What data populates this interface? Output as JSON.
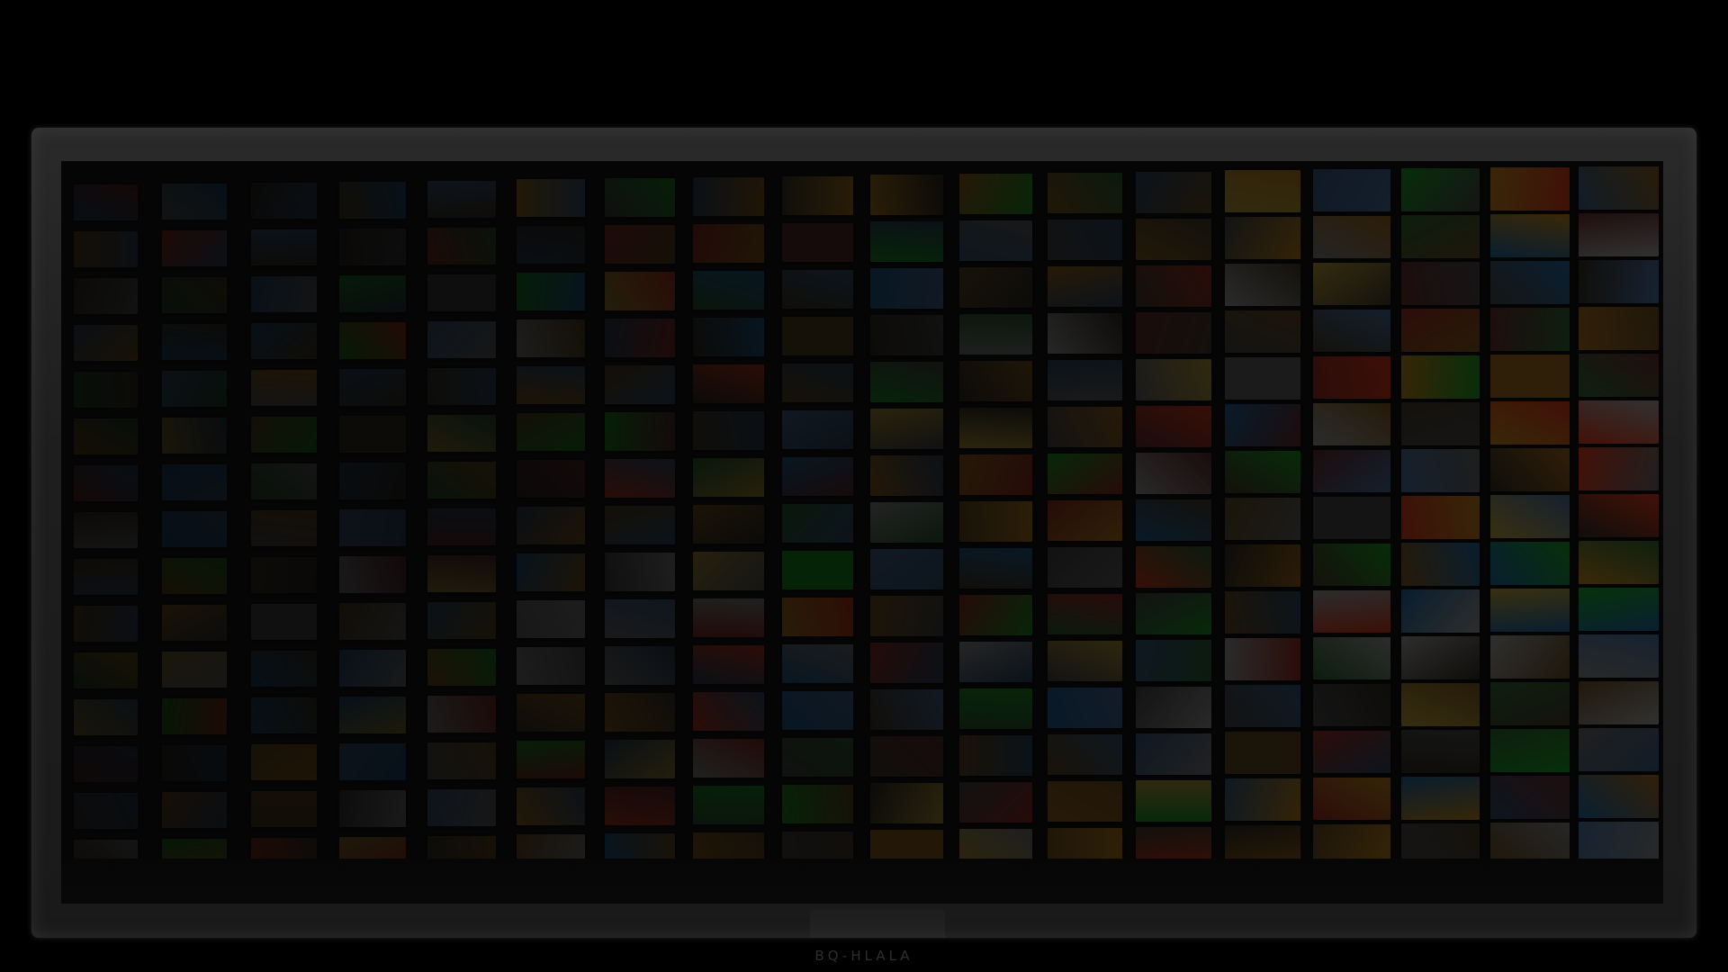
{
  "display": {
    "brand_text": "BQ-HLALA"
  },
  "colors": {
    "background": "#000000",
    "bezel": "#222222",
    "screen": "#0a0a0a"
  },
  "video_wall": {
    "columns": 18,
    "rows": 15,
    "tile_palette": [
      "#1d1a14",
      "#2a2419",
      "#3a2c14",
      "#4a3412",
      "#5a3a10",
      "#6b4a10",
      "#1a2a3a",
      "#20344a",
      "#2a3f5a",
      "#123a5a",
      "#3a1a1a",
      "#5a1a14",
      "#7a2010",
      "#1a3a1e",
      "#0f5a14",
      "#2a2a2a",
      "#3a3a3a",
      "#4a4a4a",
      "#5a5a5a",
      "#6a5a20"
    ],
    "highlight_tile_color": "#0b5e10"
  }
}
